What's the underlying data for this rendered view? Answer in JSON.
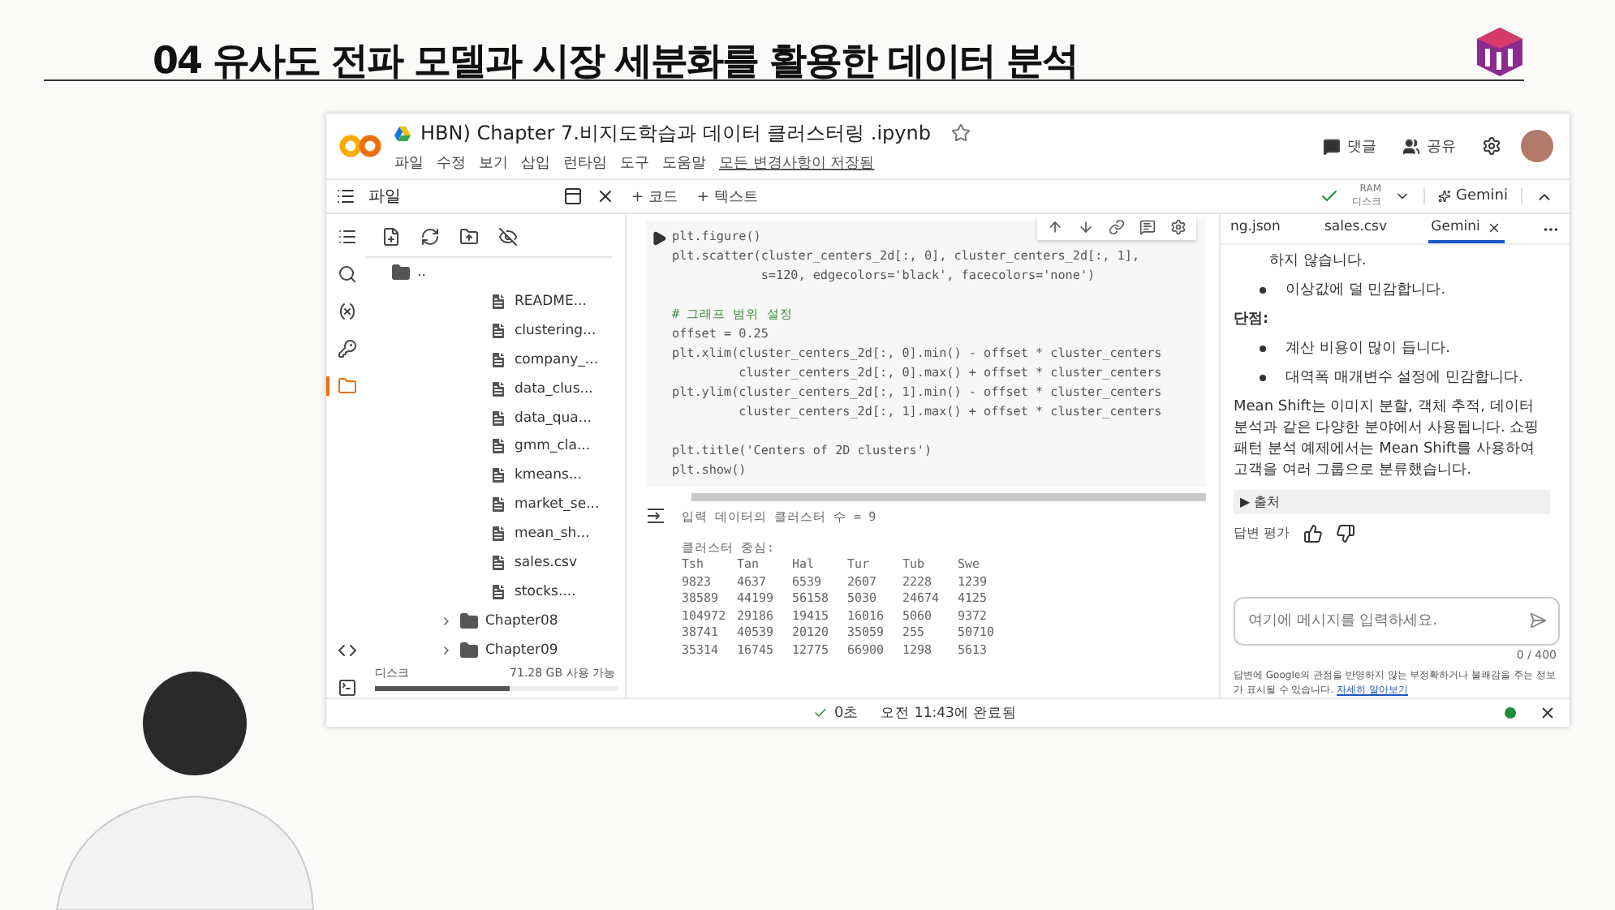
{
  "slide_title": "04 유사도 전파 모델과 시장 세분화를 활용한 데이터 분석",
  "window": {
    "title": "HBN) Chapter 7.비지도학습과 데이터 클러스터링 .ipynb",
    "menu": [
      "파일",
      "수정",
      "보기",
      "삽입",
      "런타임",
      "도구",
      "도움말"
    ],
    "save_status": "모든 변경사항이 저장됨",
    "header_actions": [
      "댓글",
      "공유"
    ]
  },
  "toolbar": {
    "panel_title": "파일",
    "add_buttons": [
      "+ 코드",
      "+ 텍스트"
    ],
    "ram_label": "RAM",
    "disk_label": "디스크",
    "gemini_button": "Gemini"
  },
  "rail": [
    {
      "kind": "toc",
      "selected": false
    },
    {
      "kind": "search",
      "selected": false
    },
    {
      "kind": "variables",
      "selected": false
    },
    {
      "kind": "secrets",
      "selected": false
    },
    {
      "kind": "files",
      "selected": true
    },
    {
      "kind": "snippets",
      "selected": false
    },
    {
      "kind": "terminal",
      "selected": false
    }
  ],
  "files": {
    "parent": "..",
    "items": [
      {
        "kind": "file",
        "name": "README..."
      },
      {
        "kind": "file",
        "name": "clustering..."
      },
      {
        "kind": "file",
        "name": "company_..."
      },
      {
        "kind": "file",
        "name": "data_clus..."
      },
      {
        "kind": "file",
        "name": "data_qua..."
      },
      {
        "kind": "file",
        "name": "gmm_cla..."
      },
      {
        "kind": "file",
        "name": "kmeans..."
      },
      {
        "kind": "file",
        "name": "market_se..."
      },
      {
        "kind": "file",
        "name": "mean_sh..."
      },
      {
        "kind": "file",
        "name": "sales.csv"
      },
      {
        "kind": "file",
        "name": "stocks...."
      },
      {
        "kind": "folder",
        "name": "Chapter08",
        "expanded": false
      },
      {
        "kind": "folder",
        "name": "Chapter09",
        "expanded": false
      }
    ],
    "disk_label": "디스크",
    "disk_free": "71.28 GB 사용 가능",
    "disk_usage": {
      "level": 0.55
    }
  },
  "code": [
    {
      "kind": "code",
      "text": "plt.figure()"
    },
    {
      "kind": "code",
      "text": "plt.scatter(cluster_centers_2d[:, 0], cluster_centers_2d[:, 1],"
    },
    {
      "kind": "code",
      "text": "            s=120, edgecolors='black', facecolors='none')"
    },
    {
      "kind": "blank"
    },
    {
      "kind": "comment",
      "text": "# 그래프 범위 설정"
    },
    {
      "kind": "code",
      "text": "offset = 0.25"
    },
    {
      "kind": "code",
      "text": "plt.xlim(cluster_centers_2d[:, 0].min() - offset * cluster_centers"
    },
    {
      "kind": "code",
      "text": "         cluster_centers_2d[:, 0].max() + offset * cluster_centers"
    },
    {
      "kind": "code",
      "text": "plt.ylim(cluster_centers_2d[:, 1].min() - offset * cluster_centers"
    },
    {
      "kind": "code",
      "text": "         cluster_centers_2d[:, 1].max() + offset * cluster_centers"
    },
    {
      "kind": "blank"
    },
    {
      "kind": "code",
      "text": "plt.title('Centers of 2D clusters')"
    },
    {
      "kind": "code",
      "text": "plt.show()"
    }
  ],
  "output": {
    "count_line": "입력 데이터의 클러스터 수 = 9",
    "centers_label": "클러스터 중심:",
    "columns": [
      "Tsh",
      "Tan",
      "Hal",
      "Tur",
      "Tub",
      "Swe"
    ],
    "rows": [
      [
        "9823",
        "4637",
        "6539",
        "2607",
        "2228",
        "1239"
      ],
      [
        "38589",
        "44199",
        "56158",
        "5030",
        "24674",
        "4125"
      ],
      [
        "104972",
        "29186",
        "19415",
        "16016",
        "5060",
        "9372"
      ],
      [
        "38741",
        "40539",
        "20120",
        "35059",
        "255",
        "50710"
      ],
      [
        "35314",
        "16745",
        "12775",
        "66900",
        "1298",
        "5613"
      ]
    ]
  },
  "gemini": {
    "tabs": [
      {
        "label": "ng.json",
        "selected": false
      },
      {
        "label": "sales.csv",
        "selected": false
      },
      {
        "label": "Gemini",
        "selected": true
      }
    ],
    "content": [
      {
        "kind": "text",
        "text": "하지 않습니다."
      },
      {
        "kind": "bullet",
        "text": "이상값에 덜 민감합니다."
      },
      {
        "kind": "heading",
        "text": "단점:"
      },
      {
        "kind": "bullet",
        "text": "계산 비용이 많이 듭니다."
      },
      {
        "kind": "bullet",
        "text": "대역폭 매개변수 설정에 민감합니다."
      },
      {
        "kind": "paragraph",
        "text": "Mean Shift는 이미지 분할, 객체 추적, 데이터 분석과 같은 다양한 분야에서 사용됩니다. 쇼핑 패턴 분석 예제에서는 Mean Shift를 사용하여 고객을 여러 그룹으로 분류했습니다."
      }
    ],
    "sources": "▶ 출처",
    "rate_label": "답변 평가",
    "placeholder": "여기에 메시지를 입력하세요.",
    "counter": "0 / 400",
    "disclaimer": "답변에 Google의 관점을 반영하지 않는 부정확하거나 불쾌감을 주는 정보가 표시될 수 있습니다.",
    "link": "자세히 알아보기"
  },
  "status": {
    "duration": "0초",
    "completed": "오전 11:43에 완료됨"
  }
}
